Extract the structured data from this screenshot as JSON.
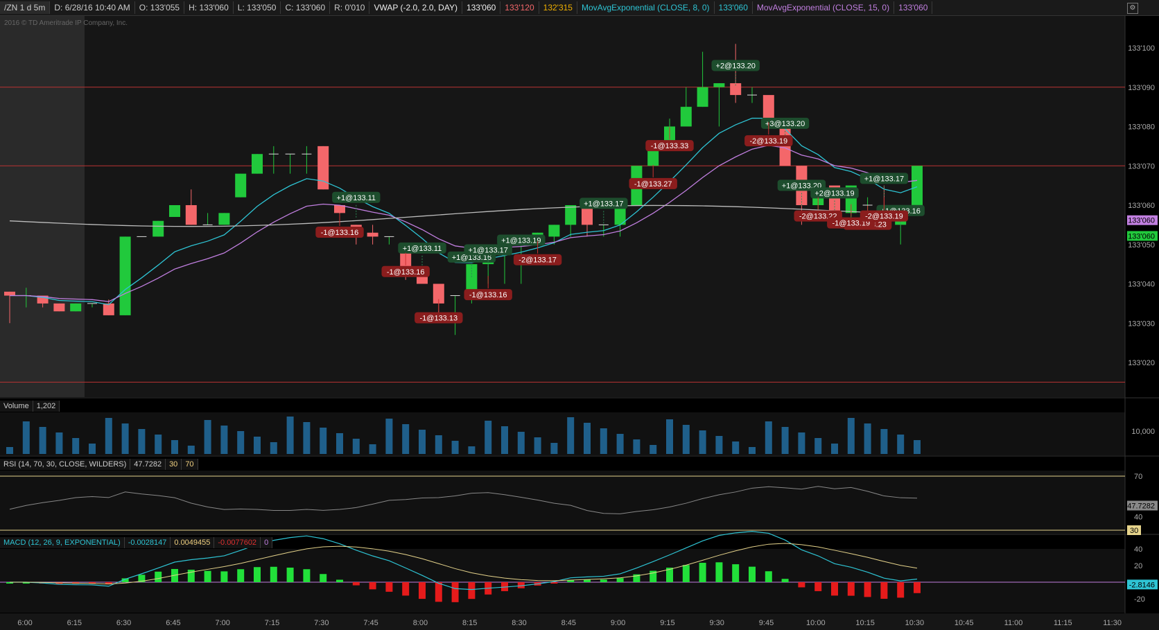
{
  "header": {
    "symbol": "/ZN 1 d 5m",
    "date": "D: 6/28/16 10:40 AM",
    "open": "O: 133'055",
    "high": "H: 133'060",
    "low": "L: 133'050",
    "close": "C: 133'060",
    "range": "R: 0'010",
    "vwap_label": "VWAP (-2.0, 2.0, DAY)",
    "vwap_v1": "133'060",
    "vwap_v2": "133'120",
    "vwap_v3": "132'315",
    "ema8_label": "MovAvgExponential (CLOSE, 8, 0)",
    "ema8_val": "133'060",
    "ema15_label": "MovAvgExponential (CLOSE, 15, 0)",
    "ema15_val": "133'060",
    "gear_icon": "gear-icon"
  },
  "copyright": "2016 © TD Ameritrade IP Company, Inc.",
  "colors": {
    "up": "#21c93c",
    "down": "#f4676a",
    "ema8": "#2ec4d4",
    "ema15": "#c17fe0",
    "vwap": "#bdbdbd",
    "line_red": "#c33",
    "vol": "#1f5f8a"
  },
  "price_axis": {
    "labels": [
      "133'100",
      "133'090",
      "133'080",
      "133'070",
      "133'060",
      "133'050",
      "133'040",
      "133'030",
      "133'020"
    ],
    "badge_ema15": "133'060",
    "badge_close": "133'060"
  },
  "time_axis": {
    "labels": [
      "6:00",
      "6:15",
      "6:30",
      "6:45",
      "7:00",
      "7:15",
      "7:30",
      "7:45",
      "8:00",
      "8:15",
      "8:30",
      "8:45",
      "9:00",
      "9:15",
      "9:30",
      "9:45",
      "10:00",
      "10:15",
      "10:30",
      "10:45",
      "11:00",
      "11:15",
      "11:30"
    ]
  },
  "trades_buy": [
    {
      "t": "+1@133.11",
      "i": 21
    },
    {
      "t": "+1@133.11",
      "i": 25
    },
    {
      "t": "+1@133.16",
      "i": 28
    },
    {
      "t": "+1@133.17",
      "i": 29
    },
    {
      "t": "+1@133.19",
      "i": 31
    },
    {
      "t": "+1@133.17",
      "i": 36
    },
    {
      "t": "+2@133.20",
      "i": 44
    },
    {
      "t": "+1@133.20",
      "i": 48
    },
    {
      "t": "+3@133.20",
      "i": 47
    },
    {
      "t": "+2@133.19",
      "i": 50
    },
    {
      "t": "+1@133.17",
      "i": 53
    },
    {
      "t": "+1@133.16",
      "i": 54
    }
  ],
  "trades_sell": [
    {
      "t": "-1@133.16",
      "i": 20
    },
    {
      "t": "-1@133.16",
      "i": 24
    },
    {
      "t": "-1@133.13",
      "i": 26
    },
    {
      "t": "-1@133.16",
      "i": 29
    },
    {
      "t": "-2@133.17",
      "i": 32
    },
    {
      "t": "-1@133.27",
      "i": 39
    },
    {
      "t": "-1@133.33",
      "i": 40
    },
    {
      "t": "-2@133.19",
      "i": 46
    },
    {
      "t": "-2@133.22",
      "i": 49
    },
    {
      "t": "-1@133.23",
      "i": 52
    },
    {
      "t": "-1@133.19",
      "i": 51
    },
    {
      "t": "-2@133.19",
      "i": 53
    }
  ],
  "volume": {
    "label": "Volume",
    "value": "1,202",
    "axis": "10,000"
  },
  "rsi": {
    "label": "RSI (14, 70, 30, CLOSE, WILDERS)",
    "value": "47.7282",
    "l30": "30",
    "l70": "70",
    "axis70": "70",
    "axis40": "40",
    "badge": "47.7282",
    "axis30": "30"
  },
  "macd": {
    "label": "MACD (12, 26, 9, EXPONENTIAL)",
    "v1": "-0.0028147",
    "v2": "0.0049455",
    "v3": "-0.0077602",
    "v4": "0",
    "axis": [
      "40",
      "20",
      "-20"
    ],
    "badge": "-2.8146"
  },
  "chart_data": {
    "type": "candlestick",
    "candles": [
      [
        38,
        38,
        30,
        37
      ],
      [
        37,
        39,
        34,
        37
      ],
      [
        37,
        37,
        34,
        35
      ],
      [
        35,
        35,
        33,
        33
      ],
      [
        33,
        35,
        33,
        35
      ],
      [
        35,
        35,
        34,
        35
      ],
      [
        35,
        36,
        32,
        32
      ],
      [
        32,
        52,
        32,
        52
      ],
      [
        52,
        52,
        52,
        52
      ],
      [
        52,
        56,
        52,
        56
      ],
      [
        57,
        60,
        57,
        60
      ],
      [
        60,
        64,
        55,
        55
      ],
      [
        55,
        58,
        55,
        55
      ],
      [
        55,
        58,
        55,
        58
      ],
      [
        62,
        68,
        62,
        68
      ],
      [
        68,
        73,
        68,
        73
      ],
      [
        73,
        75,
        68,
        73
      ],
      [
        73,
        73,
        68,
        73
      ],
      [
        73,
        75,
        68,
        73
      ],
      [
        75,
        75,
        64,
        64
      ],
      [
        60,
        60,
        55,
        58
      ],
      [
        55,
        55,
        50,
        53
      ],
      [
        53,
        55,
        50,
        52
      ],
      [
        52,
        52,
        50,
        52
      ],
      [
        50,
        50,
        41,
        44
      ],
      [
        44,
        44,
        41,
        40
      ],
      [
        40,
        40,
        30,
        35
      ],
      [
        37,
        37,
        27,
        37
      ],
      [
        38,
        45,
        35,
        45
      ],
      [
        45,
        45,
        40,
        50
      ],
      [
        50,
        50,
        40,
        50
      ],
      [
        51,
        51,
        40,
        51
      ],
      [
        51,
        53,
        51,
        53
      ],
      [
        52,
        55,
        50,
        55
      ],
      [
        55,
        60,
        52,
        60
      ],
      [
        60,
        60,
        52,
        55
      ],
      [
        55,
        55,
        52,
        55
      ],
      [
        55,
        60,
        52,
        60
      ],
      [
        60,
        70,
        60,
        70
      ],
      [
        70,
        75,
        70,
        75
      ],
      [
        75,
        82,
        75,
        80
      ],
      [
        80,
        90,
        80,
        85
      ],
      [
        85,
        99,
        85,
        90
      ],
      [
        90,
        91,
        80,
        91
      ],
      [
        91,
        101,
        86,
        88
      ],
      [
        88,
        90,
        86,
        88
      ],
      [
        88,
        85,
        80,
        82
      ],
      [
        82,
        82,
        72,
        70
      ],
      [
        70,
        70,
        55,
        60
      ],
      [
        60,
        65,
        58,
        65
      ],
      [
        65,
        62,
        55,
        58
      ],
      [
        58,
        65,
        55,
        65
      ],
      [
        60,
        62,
        58,
        60
      ],
      [
        60,
        65,
        55,
        55
      ],
      [
        55,
        60,
        50,
        60
      ],
      [
        60,
        70,
        60,
        70
      ]
    ]
  }
}
